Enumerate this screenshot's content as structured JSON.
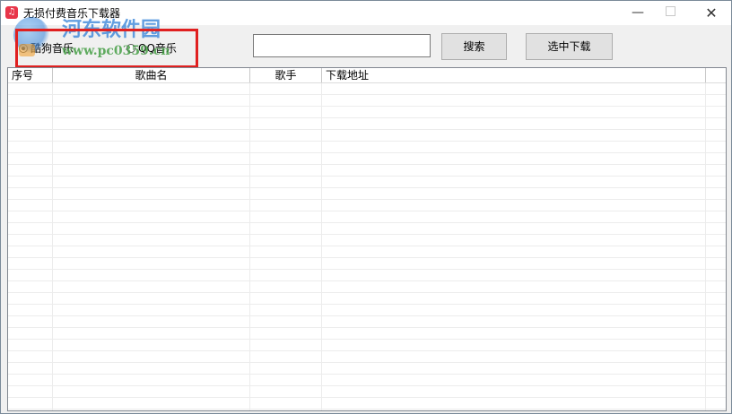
{
  "window": {
    "title": "无损付费音乐下载器",
    "app_icon_glyph": "♫",
    "min_glyph": "—",
    "close_glyph": "✕"
  },
  "source_options": {
    "kugou_label": "酷狗音乐",
    "qq_label": "QQ音乐",
    "selected": "kugou"
  },
  "search": {
    "value": "",
    "placeholder": ""
  },
  "buttons": {
    "search_label": "搜索",
    "download_label": "选中下载"
  },
  "table": {
    "columns": [
      "序号",
      "歌曲名",
      "歌手",
      "下载地址"
    ],
    "rows": []
  },
  "watermark": {
    "text": "河东软件园",
    "url": "www.pc0359.cn"
  },
  "colors": {
    "highlight": "#e02020",
    "watermark_blue": "#2f7fd8",
    "watermark_green": "#3d9a3d"
  }
}
